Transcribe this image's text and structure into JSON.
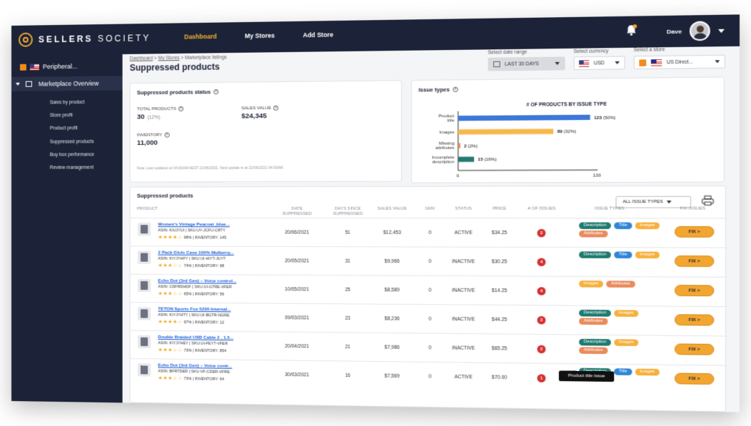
{
  "brand": {
    "name_bold": "SELLERS",
    "name_light": " SOCIETY"
  },
  "nav": [
    {
      "label": "Dashboard",
      "active": true
    },
    {
      "label": "My Stores",
      "active": false
    },
    {
      "label": "Add Store",
      "active": false
    }
  ],
  "user": {
    "name": "Dave"
  },
  "sidebar": {
    "store": "Peripheral...",
    "section": "Marketplace Overview",
    "items": [
      "Sales by product",
      "Store profit",
      "Product profit",
      "Suppressed products",
      "Buy box performance",
      "Review management"
    ]
  },
  "breadcrumb": {
    "home": "Dashboard",
    "stores": "My Stores",
    "current": "Marketplace listings"
  },
  "page_title": "Suppressed products",
  "filters": {
    "date_label": "Select date range",
    "date_value": "LAST 30 DAYS",
    "currency_label": "Select currency",
    "currency_value": "USD",
    "store_label": "Select a store",
    "store_value": "US Direct..."
  },
  "status_card": {
    "title": "Suppressed products status",
    "total_label": "TOTAL PRODUCTS",
    "total_value": "30",
    "total_pct": "(12%)",
    "sales_label": "SALES VALUE",
    "sales_value": "$24,345",
    "inventory_label": "INVENTORY",
    "inventory_value": "11,000",
    "note": "Note: Last updated on 04:00AM AEST 21/06/2021. Next update is at 22/06/2021 04:00AM."
  },
  "issue_card": {
    "title": "Issue types",
    "chart_data": {
      "type": "bar",
      "title": "# OF PRODUCTS BY ISSUE TYPE",
      "orientation": "horizontal",
      "categories": [
        "Product title",
        "Images",
        "Missing attributes",
        "Incomplete description"
      ],
      "values": [
        123,
        89,
        2,
        15
      ],
      "percent_labels": [
        "(50%)",
        "(32%)",
        "(2%)",
        "(16%)"
      ],
      "colors": [
        "#3c78d8",
        "#f7b84b",
        "#e0875e",
        "#247a70"
      ],
      "xlim": [
        0,
        130
      ],
      "xticks": [
        "0",
        "130"
      ]
    }
  },
  "table": {
    "title": "Suppressed products",
    "filter_label": "ALL ISSUE TYPES",
    "headers": {
      "product": "PRODUCT",
      "date": "DATE SUPPRESSED",
      "days": "DAYS SINCE SUPPRESSED",
      "sales": "SALES VALUE",
      "gmv": "GMV",
      "status": "STATUS",
      "price": "PRICE",
      "issues": "# OF ISSUES",
      "types": "ISSUE TYPES",
      "fix": "FIX ISSUES"
    },
    "fix_label": "FIX >",
    "rows": [
      {
        "name": "Women's Vintage Peacoat ,blue...",
        "asin": "ASIN: KIUJYUI  |  SKU:UY-JCFU-CRTY",
        "rating": "98%  |  INVENTORY: 145",
        "stars": "★★★★☆",
        "date": "20/06/2021",
        "days": "51",
        "sales": "$12,453",
        "gmv": "0",
        "status": "ACTIVE",
        "price": "$34.25",
        "issues": "2",
        "tags": [
          "Description",
          "Title",
          "Images",
          "Attributes"
        ]
      },
      {
        "name": "2 Pack Glolo Case 100% Mulberry...",
        "asin": "ASIN: KIYJYHFY  |  SKU:UI-HIYT-JUYT",
        "rating": "74%  |  INVENTORY: 98",
        "stars": "★★★☆☆",
        "date": "20/05/2021",
        "days": "31",
        "sales": "$9,966",
        "gmv": "0",
        "status": "INACTIVE",
        "price": "$30.25",
        "issues": "4",
        "tags": [
          "Description",
          "Title",
          "Images"
        ]
      },
      {
        "name": "Echo Dot (3rd Gen) – Voice control...",
        "asin": "ASIN: CDFRDHDF  |  SKU:UI-GTRE-VFER",
        "rating": "65%  |  INVENTORY: 56",
        "stars": "★★★☆☆",
        "date": "10/05/2021",
        "days": "25",
        "sales": "$8,589",
        "gmv": "0",
        "status": "INACTIVE",
        "price": "$14.25",
        "issues": "4",
        "tags": [
          "Images",
          "Attributes"
        ]
      },
      {
        "name": "TETON Sports Fox 5200 Internal...",
        "asin": "ASIN: KIYJYHTY  |  SKU:UI-BGTR-NGRE",
        "rating": "97%  |  INVENTORY: 12",
        "stars": "★★★★☆",
        "date": "09/03/2021",
        "days": "23",
        "sales": "$8,236",
        "gmv": "0",
        "status": "INACTIVE",
        "price": "$44.25",
        "issues": "3",
        "tags": [
          "Description",
          "Images",
          "Attributes"
        ]
      },
      {
        "name": "Double Braided USB Cable 2 , 1.5...",
        "asin": "ASIN: KIYJYHEY  |  SKU:UI-FEYT-VFER",
        "rating": "73%  |  INVENTORY: 854",
        "stars": "★★★☆☆",
        "date": "20/04/2021",
        "days": "21",
        "sales": "$7,986",
        "gmv": "0",
        "status": "INACTIVE",
        "price": "$65.25",
        "issues": "2",
        "tags": [
          "Description",
          "Images",
          "Attributes"
        ]
      },
      {
        "name": "Echo Dot (3rd Gen) – Voice contr...",
        "asin": "ASIN: BFRTDER  |  SKU:VF-CDER-VFRE",
        "rating": "73%  |  INVENTORY: 64",
        "stars": "★★★☆☆",
        "date": "30/03/2021",
        "days": "16",
        "sales": "$7,569",
        "gmv": "0",
        "status": "ACTIVE",
        "price": "$70.00",
        "issues": "1",
        "tags": [
          "Description",
          "Title",
          "Images"
        ]
      }
    ]
  },
  "tooltip": "Product title issue"
}
